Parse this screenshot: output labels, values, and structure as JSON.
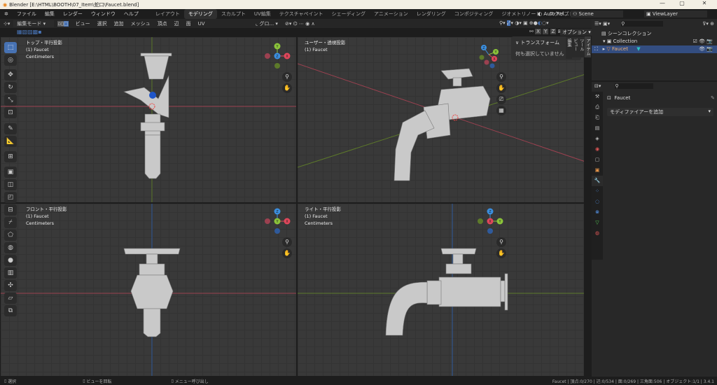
{
  "window": {
    "title": "Blender [E:\\HTML\\BOOTH\\07_Item\\蛇口\\Faucet.blend]",
    "minimize": "—",
    "maximize": "▢",
    "close": "✕"
  },
  "menu": [
    "ファイル",
    "編集",
    "レンダー",
    "ウィンドウ",
    "ヘルプ"
  ],
  "workspaces": [
    "レイアウト",
    "モデリング",
    "スカルプト",
    "UV編集",
    "テクスチャペイント",
    "シェーディング",
    "アニメーション",
    "レンダリング",
    "コンポジティング",
    "ジオメトリノード",
    "スクリプト作成",
    "+"
  ],
  "topright": {
    "auto_run": "Auto Rel...",
    "scene": "Scene",
    "view_layer": "ViewLayer"
  },
  "header": {
    "mode": "編集モード",
    "menus": [
      "ビュー",
      "選択",
      "追加",
      "メッシュ",
      "頂点",
      "辺",
      "面",
      "UV"
    ],
    "transform_orient": "グロ...",
    "axes": [
      "X",
      "Y",
      "Z"
    ],
    "options": "オプション"
  },
  "viewports": [
    {
      "name": "トップ・平行投影",
      "object": "(1) Faucet",
      "units": "Centimeters",
      "gizmo": [
        "Y",
        "Z",
        "X"
      ]
    },
    {
      "name": "ユーザー・透視投影",
      "object": "(1) Faucet",
      "units": "",
      "gizmo": [
        "Z",
        "Y",
        "X"
      ]
    },
    {
      "name": "フロント・平行投影",
      "object": "(1) Faucet",
      "units": "Centimeters",
      "gizmo": [
        "Z",
        "Y",
        "X"
      ]
    },
    {
      "name": "ライト・平行投影",
      "object": "(1) Faucet",
      "units": "Centimeters",
      "gizmo": [
        "Z",
        "X",
        "Y"
      ]
    }
  ],
  "npanel": {
    "section": "トランスフォーム",
    "message": "何も選択していません",
    "tabs": [
      "アイテム",
      "ツール",
      "ビュー",
      "編集"
    ]
  },
  "outliner": {
    "root": "シーンコレクション",
    "collection": "Collection",
    "object": "Faucet"
  },
  "properties": {
    "object": "Faucet",
    "add_modifier": "モディファイアーを追加"
  },
  "status": {
    "left": "選択",
    "middle": "ビューを回転",
    "right": "メニュー呼び出し",
    "stats": "Faucet | 頂点:0/270 | 辺:0/534 | 面:0/269 | 三角面:506 | オブジェクト:1/1 | 3.4.1"
  },
  "colors": {
    "accent": "#4772b3",
    "x_axis": "#e2475b",
    "y_axis": "#8bc43a",
    "z_axis": "#3b8fe0"
  }
}
